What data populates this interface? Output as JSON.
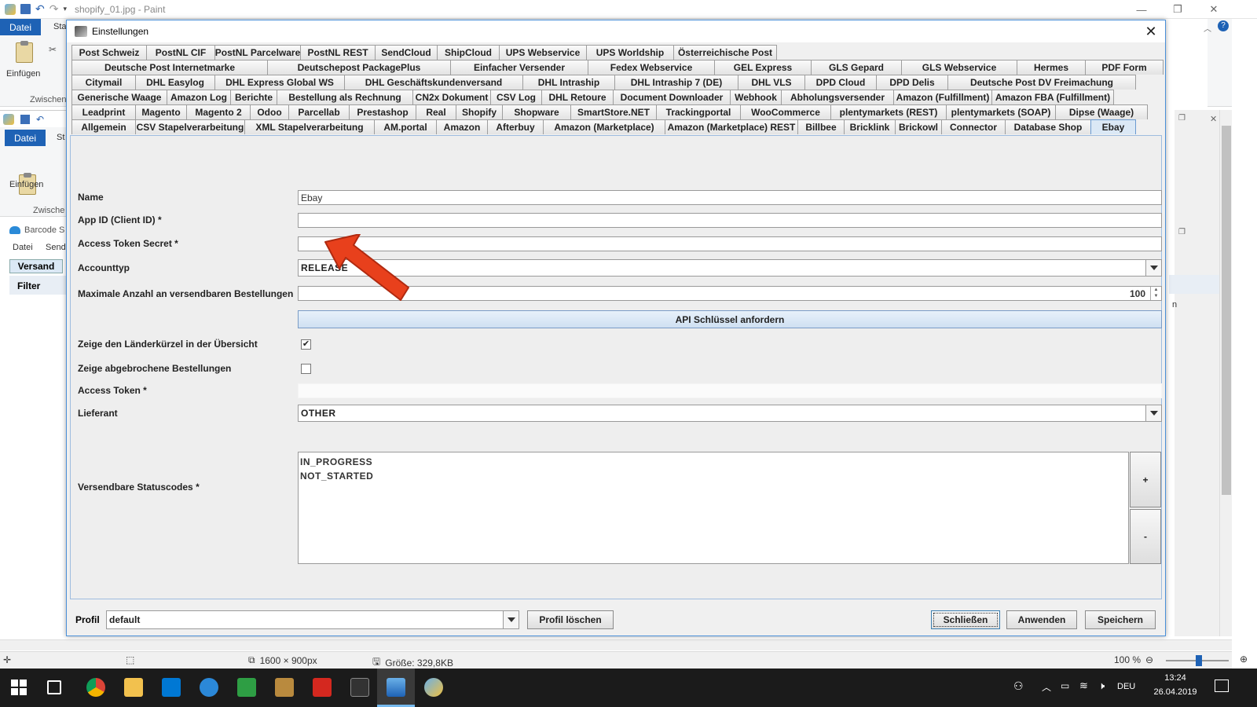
{
  "paint": {
    "title": "shopify_01.jpg - Paint",
    "datei_tab": "Datei",
    "start_tab_partial": "Sta",
    "paste_label": "Einfügen",
    "clipboard_partial": "Zwischen"
  },
  "inner_app": {
    "datei_tab": "Datei",
    "start_tab_partial": "St",
    "paste_label": "Einfügen",
    "clipboard_partial": "Zwische",
    "barcode_title_partial": "Barcode S",
    "menu_datei": "Datei",
    "menu_send_partial": "Send",
    "tab_versand": "Versand",
    "filter_label": "Filter",
    "right_col_partial": "n"
  },
  "dialog": {
    "title": "Einstellungen",
    "tab_rows": [
      [
        "Post Schweiz",
        "PostNL CIF",
        "PostNL Parcelware",
        "PostNL REST",
        "SendCloud",
        "ShipCloud",
        "UPS Webservice",
        "UPS Worldship",
        "Österreichische Post"
      ],
      [
        "Deutsche Post Internetmarke",
        "Deutschepost PackagePlus",
        "Einfacher Versender",
        "Fedex Webservice",
        "GEL Express",
        "GLS Gepard",
        "GLS Webservice",
        "Hermes",
        "PDF Form"
      ],
      [
        "Citymail",
        "DHL Easylog",
        "DHL Express Global WS",
        "DHL Geschäftskundenversand",
        "DHL Intraship",
        "DHL Intraship 7 (DE)",
        "DHL VLS",
        "DPD Cloud",
        "DPD Delis",
        "Deutsche Post DV Freimachung"
      ],
      [
        "Generische Waage",
        "Amazon Log",
        "Berichte",
        "Bestellung als Rechnung",
        "CN2x Dokument",
        "CSV Log",
        "DHL Retoure",
        "Document Downloader",
        "Webhook",
        "Abholungsversender",
        "Amazon (Fulfillment)",
        "Amazon FBA (Fulfillment)"
      ],
      [
        "Leadprint",
        "Magento",
        "Magento 2",
        "Odoo",
        "Parcellab",
        "Prestashop",
        "Real",
        "Shopify",
        "Shopware",
        "SmartStore.NET",
        "Trackingportal",
        "WooCommerce",
        "plentymarkets (REST)",
        "plentymarkets (SOAP)",
        "Dipse (Waage)"
      ],
      [
        "Allgemein",
        "CSV Stapelverarbeitung",
        "XML Stapelverarbeitung",
        "AM.portal",
        "Amazon",
        "Afterbuy",
        "Amazon (Marketplace)",
        "Amazon (Marketplace) REST",
        "Billbee",
        "Bricklink",
        "Brickowl",
        "Connector",
        "Database Shop",
        "Ebay"
      ]
    ],
    "active_tab": "Ebay",
    "form": {
      "name_label": "Name",
      "name_value": "Ebay",
      "app_id_label": "App ID (Client ID) *",
      "app_id_value": "",
      "access_token_secret_label": "Access Token Secret *",
      "access_token_secret_value": "",
      "accounttyp_label": "Accounttyp",
      "accounttyp_value": "RELEASE",
      "max_orders_label": "Maximale Anzahl an versendbaren Bestellungen",
      "max_orders_value": "100",
      "api_key_button": "API Schlüssel anfordern",
      "show_country_label": "Zeige den Länderkürzel in der Übersicht",
      "show_country_checked": true,
      "show_cancelled_label": "Zeige abgebrochene Bestellungen",
      "show_cancelled_checked": false,
      "access_token_label": "Access Token *",
      "access_token_value": "",
      "lieferant_label": "Lieferant",
      "lieferant_value": "OTHER",
      "status_codes_label": "Versendbare Statuscodes *",
      "status_codes": [
        "IN_PROGRESS",
        "NOT_STARTED"
      ],
      "add_button": "+",
      "remove_button": "-"
    },
    "footer": {
      "profil_label": "Profil",
      "profil_value": "default",
      "delete_profile_button": "Profil löschen",
      "close_button": "Schließen",
      "apply_button": "Anwenden",
      "save_button": "Speichern"
    }
  },
  "statusbar": {
    "dimensions": "1600 × 900px",
    "size": "Größe: 329,8KB",
    "zoom": "100 %"
  },
  "taskbar": {
    "language": "DEU",
    "time": "13:24",
    "date": "26.04.2019"
  },
  "colors": {
    "accent": "#1e62b5",
    "arrow": "#e8401c",
    "taskbar": "#1b1b1b"
  }
}
